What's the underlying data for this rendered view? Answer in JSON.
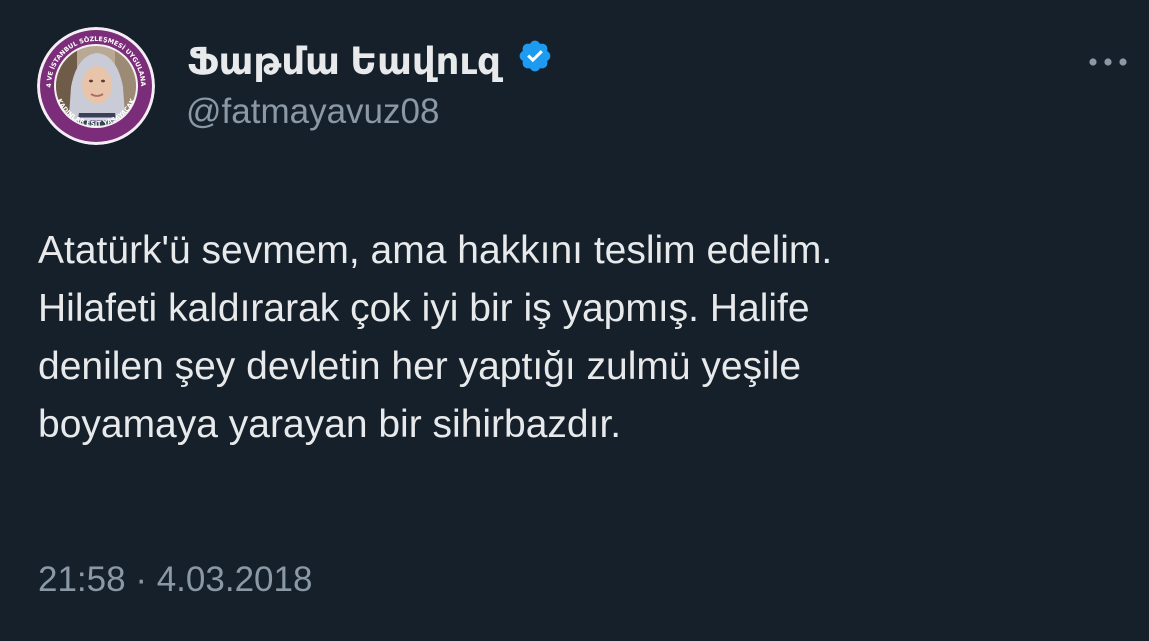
{
  "author": {
    "display_name": "Ֆաթմա Եավուզ",
    "handle": "@fatmayavuz08",
    "verified": true,
    "avatar_ring_text": "6284 VE İSTANBUL SÖZLEŞMESİ UYGULANACAK · KADINLAR EŞİT YAŞAYACAK"
  },
  "tweet": {
    "lines": [
      "Atatürk'ü sevmem, ama hakkını teslim edelim.",
      "Hilafeti kaldırarak çok iyi bir iş yapmış. Halife",
      "denilen şey devletin her yaptığı zulmü yeşile",
      "boyamaya yarayan bir sihirbazdır."
    ],
    "time": "21:58",
    "separator": "·",
    "date": "4.03.2018"
  },
  "icons": {
    "verified": "verified-badge-icon",
    "more": "more-options-icon"
  },
  "colors": {
    "background": "#15202b",
    "primary_text": "#e7e9ea",
    "secondary_text": "#8b98a5",
    "verified_blue": "#1d9bf0",
    "avatar_ring": "#7b2d7a"
  }
}
